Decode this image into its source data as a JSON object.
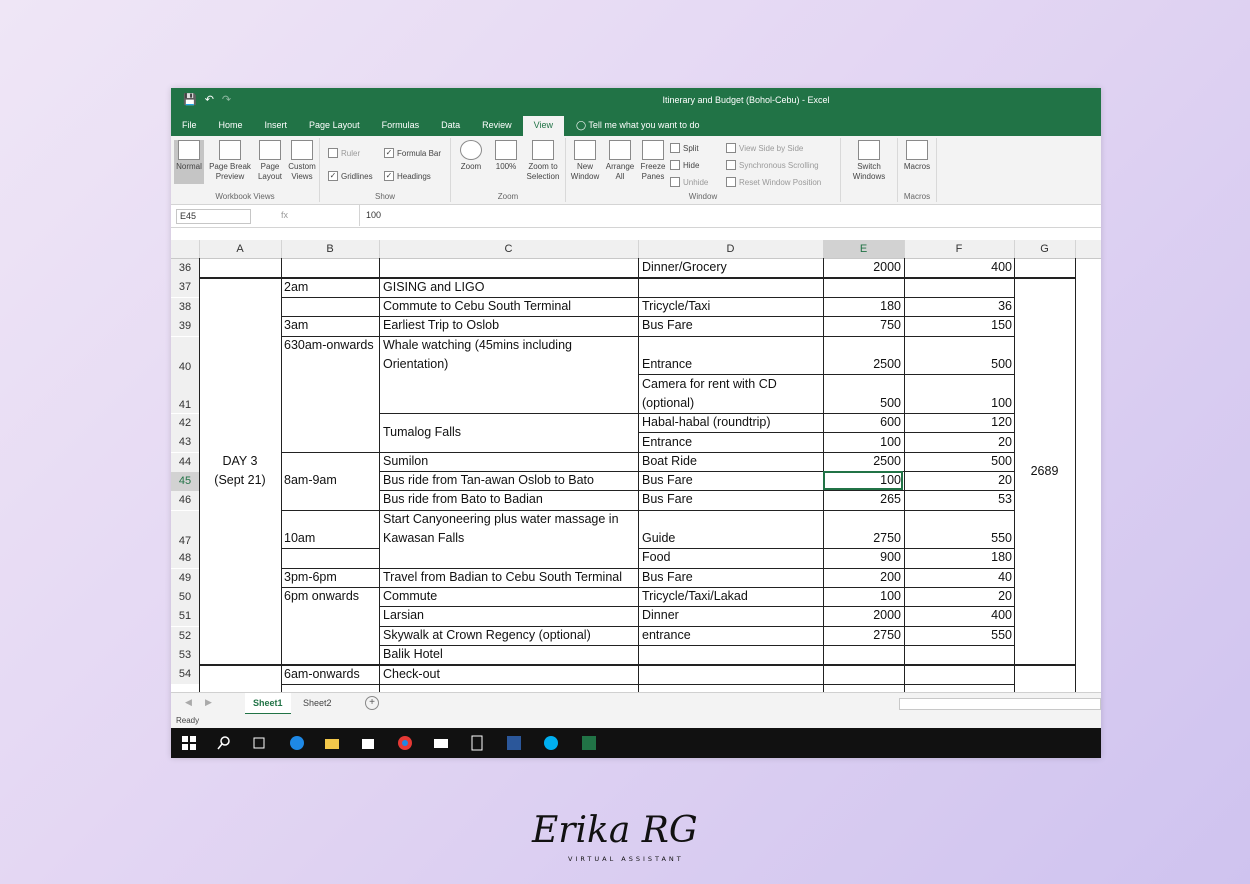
{
  "window": {
    "title": "Itinerary and Budget (Bohol-Cebu) - Excel"
  },
  "tabs": [
    "File",
    "Home",
    "Insert",
    "Page Layout",
    "Formulas",
    "Data",
    "Review",
    "View"
  ],
  "active_tab": "View",
  "tell_me": "Tell me what you want to do",
  "ribbon": {
    "workbook_views": {
      "label": "Workbook Views",
      "normal": "Normal",
      "page_break_1": "Page Break",
      "page_break_2": "Preview",
      "page_layout_1": "Page",
      "page_layout_2": "Layout",
      "custom_1": "Custom",
      "custom_2": "Views"
    },
    "show": {
      "label": "Show",
      "ruler": "Ruler",
      "formula_bar": "Formula Bar",
      "gridlines": "Gridlines",
      "headings": "Headings"
    },
    "zoom": {
      "label": "Zoom",
      "zoom": "Zoom",
      "hundred": "100%",
      "zoom_sel_1": "Zoom to",
      "zoom_sel_2": "Selection"
    },
    "window": {
      "label": "Window",
      "new_1": "New",
      "new_2": "Window",
      "arrange_1": "Arrange",
      "arrange_2": "All",
      "freeze_1": "Freeze",
      "freeze_2": "Panes",
      "split": "Split",
      "hide": "Hide",
      "unhide": "Unhide",
      "side_by_side": "View Side by Side",
      "sync_scroll": "Synchronous Scrolling",
      "reset_pos": "Reset Window Position",
      "switch_1": "Switch",
      "switch_2": "Windows"
    },
    "macros": {
      "label": "Macros",
      "macros": "Macros"
    }
  },
  "formula_bar": {
    "name_box": "E45",
    "fx": "fx",
    "value": "100"
  },
  "columns": [
    "A",
    "B",
    "C",
    "D",
    "E",
    "F",
    "G"
  ],
  "rows": [
    "36",
    "37",
    "38",
    "39",
    "40",
    "41",
    "42",
    "43",
    "44",
    "45",
    "46",
    "47",
    "48",
    "49",
    "50",
    "51",
    "52",
    "53",
    "54"
  ],
  "cells": {
    "d36": "Dinner/Grocery",
    "e36": "2000",
    "f36": "400",
    "b37": "2am",
    "c37": "GISING and LIGO",
    "c38": "Commute to Cebu South Terminal",
    "d38": "Tricycle/Taxi",
    "e38": "180",
    "f38": "36",
    "b39": "3am",
    "c39": "Earliest Trip to Oslob",
    "d39": "Bus Fare",
    "e39": "750",
    "f39": "150",
    "b40": "630am-onwards",
    "c40a": "Whale watching (45mins including",
    "c40b": "Orientation)",
    "d40": "Entrance",
    "e40": "2500",
    "f40": "500",
    "d41a": "Camera for rent with CD",
    "d41b": "(optional)",
    "e41": "500",
    "f41": "100",
    "c42": "Tumalog Falls",
    "d42": "Habal-habal (roundtrip)",
    "e42": "600",
    "f42": "120",
    "d43": "Entrance",
    "e43": "100",
    "f43": "20",
    "a44": "DAY 3",
    "a45": "(Sept 21)",
    "c44": "Sumilon",
    "d44": "Boat Ride",
    "e44": "2500",
    "f44": "500",
    "g44": "2689",
    "b45": "8am-9am",
    "c45": "Bus ride from Tan-awan Oslob to Bato",
    "d45": "Bus Fare",
    "e45": "100",
    "f45": "20",
    "c46": "Bus ride from Bato to Badian",
    "d46": "Bus Fare",
    "e46": "265",
    "f46": "53",
    "b47": "10am",
    "c47a": "Start Canyoneering plus water massage in",
    "c47b": "Kawasan Falls",
    "d47": "Guide",
    "e47": "2750",
    "f47": "550",
    "d48": "Food",
    "e48": "900",
    "f48": "180",
    "b49": "3pm-6pm",
    "c49": "Travel from Badian to Cebu South Terminal",
    "d49": "Bus Fare",
    "e49": "200",
    "f49": "40",
    "b50": "6pm onwards",
    "c50": "Commute",
    "d50": "Tricycle/Taxi/Lakad",
    "e50": "100",
    "f50": "20",
    "c51": "Larsian",
    "d51": "Dinner",
    "e51": "2000",
    "f51": "400",
    "c52": "Skywalk at Crown Regency (optional)",
    "d52": "entrance",
    "e52": "2750",
    "f52": "550",
    "c53": "Balik Hotel",
    "b54": "6am-onwards",
    "c54": "Check-out"
  },
  "sheets": [
    "Sheet1",
    "Sheet2"
  ],
  "active_sheet": "Sheet1",
  "status": "Ready",
  "watermark": {
    "name": "Erika RG",
    "tagline": "VIRTUAL ASSISTANT"
  },
  "colors": {
    "excel_green": "#217346"
  }
}
